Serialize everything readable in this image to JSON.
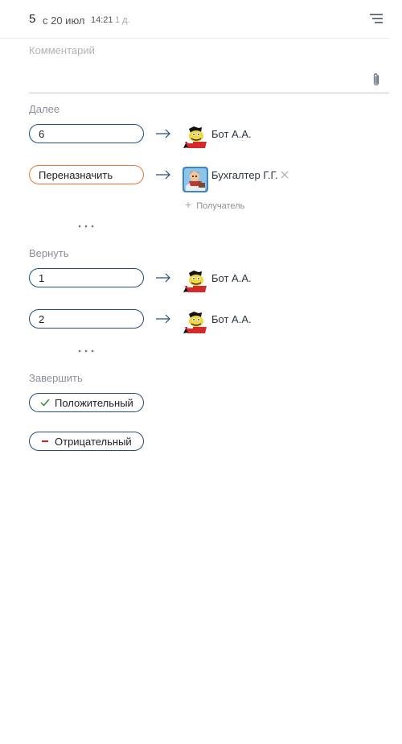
{
  "header": {
    "step_number": "5",
    "date_prefix": "с 20 июл",
    "time": "14:21",
    "duration": "1 д."
  },
  "comment": {
    "placeholder": "Комментарий"
  },
  "next_section": {
    "title": "Далее",
    "items": [
      {
        "label": "6",
        "person": "Бот А.А.",
        "avatar": "cartoon-bot-avatar"
      },
      {
        "label": "Переназначить",
        "person": "Бухгалтер Г.Г.",
        "avatar": "cartoon-accountant-avatar",
        "add_label": "Получатель"
      }
    ]
  },
  "return_section": {
    "title": "Вернуть",
    "items": [
      {
        "label": "1",
        "person": "Бот А.А.",
        "avatar": "cartoon-bot-avatar"
      },
      {
        "label": "2",
        "person": "Бот А.А.",
        "avatar": "cartoon-bot-avatar"
      }
    ]
  },
  "finish_section": {
    "title": "Завершить",
    "positive": "Положительный",
    "negative": "Отрицательный"
  },
  "colors": {
    "accent_blue": "#1f4f7a",
    "reassign_orange": "#ef7535",
    "positive_green": "#3a8a3a",
    "negative_red": "#c62828",
    "muted_text": "#8a8f99"
  }
}
